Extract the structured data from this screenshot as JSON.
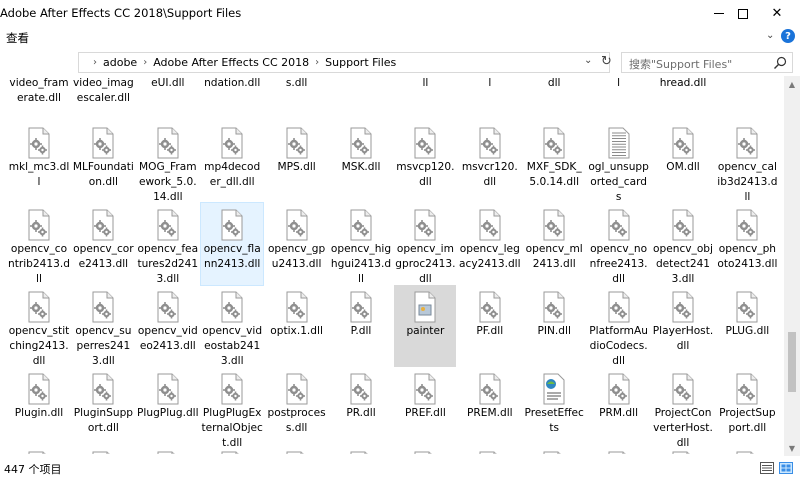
{
  "window": {
    "title": "Adobe After Effects CC 2018\\Support Files",
    "minimize_label": "",
    "maximize_label": "",
    "close_label": "✕"
  },
  "ribbon": {
    "view_tab": "查看",
    "expand_glyph": "⌄",
    "help": "?"
  },
  "address": {
    "crumbs": [
      "adobe",
      "Adobe After Effects CC 2018",
      "Support Files"
    ],
    "separator": "›"
  },
  "search": {
    "placeholder": "搜索\"Support Files\""
  },
  "status": {
    "item_count": "447 个项目"
  },
  "top_row": [
    "video_framerate.dll",
    "video_imagescaler.dll",
    "eUI.dll",
    "ndation.dll",
    "s.dll",
    "",
    "ll",
    "l",
    "dll",
    "l",
    "hread.dll",
    ""
  ],
  "files": [
    [
      "mkl_mc3.dll",
      "MLFoundation.dll",
      "MOG_Framework_5.0.14.dll",
      "mp4decoder_dll.dll",
      "MPS.dll",
      "MSK.dll",
      "msvcp120.dll",
      "msvcr120.dll",
      "MXF_SDK_5.0.14.dll",
      "ogl_unsupported_cards",
      "OM.dll",
      "opencv_calib3d2413.dll"
    ],
    [
      "opencv_contrib2413.dll",
      "opencv_core2413.dll",
      "opencv_features2d2413.dll",
      "opencv_flann2413.dll",
      "opencv_gpu2413.dll",
      "opencv_highgui2413.dll",
      "opencv_imgproc2413.dll",
      "opencv_legacy2413.dll",
      "opencv_ml2413.dll",
      "opencv_nonfree2413.dll",
      "opencv_objdetect2413.dll",
      "opencv_photo2413.dll"
    ],
    [
      "opencv_stitching2413.dll",
      "opencv_superres2413.dll",
      "opencv_video2413.dll",
      "opencv_videostab2413.dll",
      "optix.1.dll",
      "P.dll",
      "painter",
      "PF.dll",
      "PIN.dll",
      "PlatformAudioCodecs.dll",
      "PlayerHost.dll",
      "PLUG.dll"
    ],
    [
      "Plugin.dll",
      "PluginSupport.dll",
      "PlugPlug.dll",
      "PlugPlugExternalObject.dll",
      "postprocess.dll",
      "PR.dll",
      "PREF.dll",
      "PREM.dll",
      "PresetEffects",
      "PRM.dll",
      "ProjectConverterHost.dll",
      "ProjectSupport.dll"
    ]
  ],
  "colors": {
    "selection": "#e5f3ff",
    "painter_bg": "#d9d9d9",
    "help_blue": "#1a73d9"
  }
}
